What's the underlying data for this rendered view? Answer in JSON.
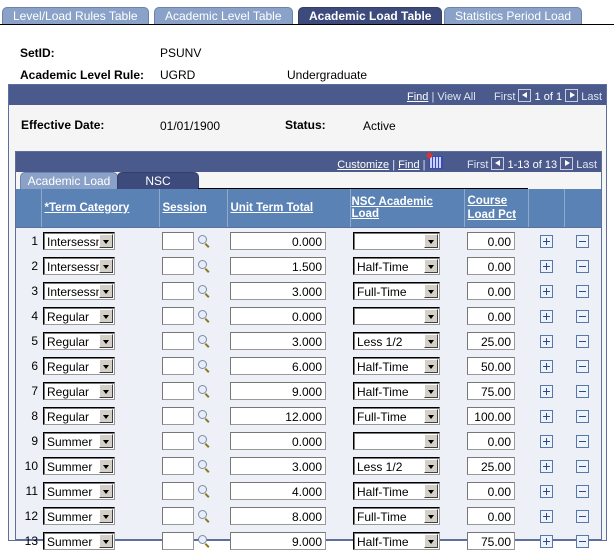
{
  "tabs": [
    {
      "label": "Level/Load Rules Table",
      "active": false
    },
    {
      "label": "Academic Level Table",
      "active": false
    },
    {
      "label": "Academic Load Table",
      "active": true
    },
    {
      "label": "Statistics Period Load",
      "active": false
    }
  ],
  "header": {
    "setid_label": "SetID:",
    "setid_value": "PSUNV",
    "level_rule_label": "Academic Level Rule:",
    "level_rule_value": "UGRD",
    "level_rule_desc": "Undergraduate"
  },
  "outer_nav": {
    "find": "Find",
    "sep": "|",
    "view_all": "View All",
    "first": "First",
    "range": "1 of 1",
    "last": "Last"
  },
  "effdt": {
    "effective_date_label": "Effective Date:",
    "effective_date_value": "01/01/1900",
    "status_label": "Status:",
    "status_value": "Active"
  },
  "grid_nav": {
    "customize": "Customize",
    "sep": "|",
    "find": "Find",
    "first": "First",
    "range": "1-13 of 13",
    "last": "Last"
  },
  "subtabs": [
    {
      "label": "Academic Load",
      "active": false
    },
    {
      "label": "NSC",
      "active": true
    }
  ],
  "columns": {
    "term_category": "*Term Category",
    "session": "Session",
    "unit_term_total": "Unit Term Total",
    "nsc_academic_load": "NSC Academic Load",
    "course_load_pct_1": "Course",
    "course_load_pct_2": "Load Pct"
  },
  "rows": [
    {
      "num": "1",
      "term": "Intersessn",
      "session": "",
      "units": "0.000",
      "nsc": "",
      "pct": "0.00"
    },
    {
      "num": "2",
      "term": "Intersessn",
      "session": "",
      "units": "1.500",
      "nsc": "Half-Time",
      "pct": "0.00"
    },
    {
      "num": "3",
      "term": "Intersessn",
      "session": "",
      "units": "3.000",
      "nsc": "Full-Time",
      "pct": "0.00"
    },
    {
      "num": "4",
      "term": "Regular",
      "session": "",
      "units": "0.000",
      "nsc": "",
      "pct": "0.00"
    },
    {
      "num": "5",
      "term": "Regular",
      "session": "",
      "units": "3.000",
      "nsc": "Less 1/2",
      "pct": "25.00"
    },
    {
      "num": "6",
      "term": "Regular",
      "session": "",
      "units": "6.000",
      "nsc": "Half-Time",
      "pct": "50.00"
    },
    {
      "num": "7",
      "term": "Regular",
      "session": "",
      "units": "9.000",
      "nsc": "Half-Time",
      "pct": "75.00"
    },
    {
      "num": "8",
      "term": "Regular",
      "session": "",
      "units": "12.000",
      "nsc": "Full-Time",
      "pct": "100.00"
    },
    {
      "num": "9",
      "term": "Summer",
      "session": "",
      "units": "0.000",
      "nsc": "",
      "pct": "0.00"
    },
    {
      "num": "10",
      "term": "Summer",
      "session": "",
      "units": "3.000",
      "nsc": "Less 1/2",
      "pct": "25.00"
    },
    {
      "num": "11",
      "term": "Summer",
      "session": "",
      "units": "4.000",
      "nsc": "Half-Time",
      "pct": "0.00"
    },
    {
      "num": "12",
      "term": "Summer",
      "session": "",
      "units": "8.000",
      "nsc": "Full-Time",
      "pct": "0.00"
    },
    {
      "num": "13",
      "term": "Summer",
      "session": "",
      "units": "9.000",
      "nsc": "Half-Time",
      "pct": "75.00"
    }
  ]
}
